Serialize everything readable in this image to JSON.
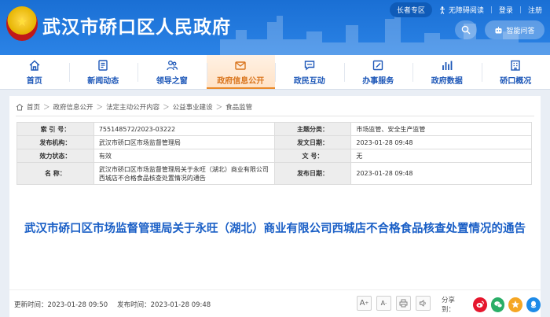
{
  "header": {
    "site_title": "武汉市硚口区人民政府",
    "elder_mode": "长者专区",
    "accessibility": "无障碍阅读",
    "login": "登录",
    "register": "注册",
    "smart_qa": "智能问答"
  },
  "nav": {
    "items": [
      {
        "label": "首页",
        "icon": "home-icon"
      },
      {
        "label": "新闻动态",
        "icon": "news-icon"
      },
      {
        "label": "领导之窗",
        "icon": "leaders-icon"
      },
      {
        "label": "政府信息公开",
        "icon": "mail-icon",
        "active": true
      },
      {
        "label": "政民互动",
        "icon": "chat-icon"
      },
      {
        "label": "办事服务",
        "icon": "edit-icon"
      },
      {
        "label": "政府数据",
        "icon": "data-icon"
      },
      {
        "label": "硚口概况",
        "icon": "building-icon"
      }
    ]
  },
  "breadcrumb": {
    "items": [
      "首页",
      "政府信息公开",
      "法定主动公开内容",
      "公益事业建设",
      "食品监管"
    ],
    "separator": "＞"
  },
  "meta": {
    "index_label": "索 引 号：",
    "index_value": "755148572/2023-03222",
    "topic_label": "主题分类：",
    "topic_value": "市场监管、安全生产监管",
    "issuer_label": "发布机构：",
    "issuer_value": "武汉市硚口区市场监督管理局",
    "issue_date_label": "发文日期：",
    "issue_date_value": "2023-01-28 09:48",
    "validity_label": "效力状态：",
    "validity_value": "有效",
    "doc_no_label": "文      号：",
    "doc_no_value": "无",
    "name_label": "名      称：",
    "name_value": "武汉市硚口区市场监督管理局关于永旺（湖北）商业有限公司西城店不合格食品核查处置情况的通告",
    "publish_date_label": "发布日期：",
    "publish_date_value": "2023-01-28 09:48"
  },
  "article": {
    "title": "武汉市硚口区市场监督管理局关于永旺（湖北）商业有限公司西城店不合格食品核查处置情况的通告",
    "updated": "更新时间：2023-01-28 09:50",
    "published": "发布时间：2023-01-28 09:48"
  },
  "tools": {
    "font_larger": "A",
    "font_smaller": "A"
  },
  "share": {
    "label": "分享到：",
    "colors": {
      "weibo": "#e6162d",
      "wechat": "#2aae67",
      "qzone": "#f5a623",
      "qq": "#1e8be8"
    }
  },
  "colors": {
    "brand": "#1a6fd4",
    "accent": "#ea8a2a",
    "title": "#1a5fc6"
  }
}
